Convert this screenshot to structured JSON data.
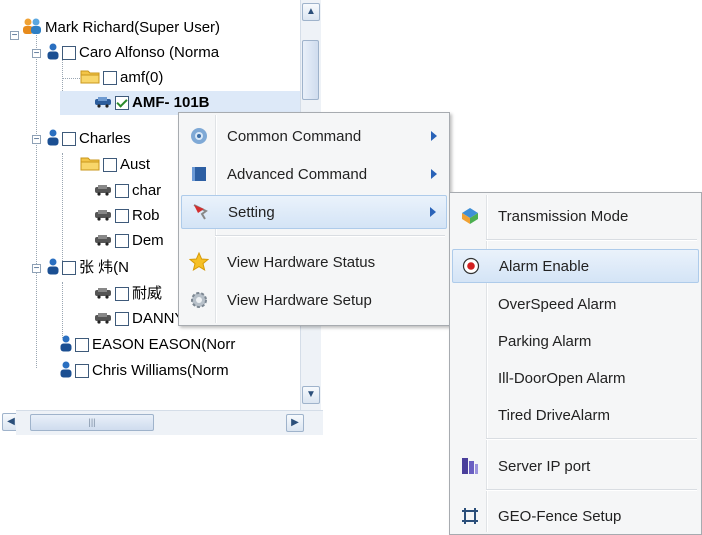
{
  "tree": {
    "root": "Mark Richard(Super User)",
    "items": [
      {
        "label": "Caro Alfonso (Norma"
      },
      {
        "label": "amf(0)"
      },
      {
        "label": "AMF- 101B"
      },
      {
        "label": "Charles"
      },
      {
        "label": "Aust"
      },
      {
        "label": "char"
      },
      {
        "label": "Rob"
      },
      {
        "label": "Dem"
      },
      {
        "label": "张 炜(N"
      },
      {
        "label": "耐威"
      },
      {
        "label": "DANNY"
      },
      {
        "label": "EASON EASON(Norr"
      },
      {
        "label": "Chris Williams(Norm"
      }
    ]
  },
  "context_menu": {
    "items": [
      {
        "label": "Common Command",
        "icon": "gear-command-icon"
      },
      {
        "label": "Advanced Command",
        "icon": "book-icon"
      },
      {
        "label": "Setting",
        "icon": "flag-icon"
      },
      {
        "label": "View Hardware Status",
        "icon": "star-icon"
      },
      {
        "label": "View Hardware Setup",
        "icon": "cog-icon"
      }
    ]
  },
  "submenu": {
    "items": [
      {
        "label": "Transmission Mode",
        "icon": "transmission-icon"
      },
      {
        "label": "Alarm Enable",
        "icon": "radio-selected-icon"
      },
      {
        "label": "OverSpeed Alarm"
      },
      {
        "label": "Parking Alarm"
      },
      {
        "label": "Ill-DoorOpen Alarm"
      },
      {
        "label": "Tired DriveAlarm"
      },
      {
        "label": "Server IP port",
        "icon": "server-icon"
      },
      {
        "label": "GEO-Fence Setup",
        "icon": "geofence-icon"
      }
    ]
  },
  "colors": {
    "highlight": "#d4e4f6",
    "menu_bg": "#f5f6f7",
    "arrow": "#2a63b8"
  }
}
